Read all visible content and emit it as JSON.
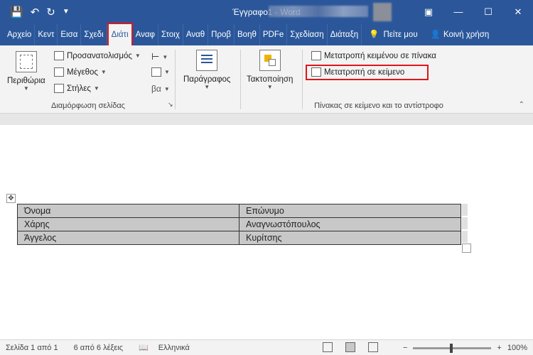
{
  "window": {
    "title": "Έγγραφο1 - Word",
    "quick_access": {
      "save_icon": "save-icon",
      "undo_icon": "undo-icon",
      "redo_icon": "redo-icon",
      "customize_icon": "customize-icon"
    },
    "controls": {
      "minimize": "—",
      "restore": "☐",
      "close": "✕",
      "ribbon_display": "▣"
    }
  },
  "tabs": [
    "Αρχείο",
    "Κεντ",
    "Εισα",
    "Σχεδι",
    "Διάτι",
    "Αναφ",
    "Στοιχ",
    "Αναθ",
    "Προβ",
    "Βοηθ",
    "PDFe",
    "Σχεδίαση",
    "Διάταξη"
  ],
  "tell_me": "Πείτε μου",
  "share": "Κοινή χρήση",
  "ribbon": {
    "page_setup": {
      "label": "Διαμόρφωση σελίδας",
      "margins": "Περιθώρια",
      "orientation": "Προσανατολισμός",
      "size": "Μέγεθος",
      "columns": "Στήλες",
      "hyphenation": "βα"
    },
    "paragraph": {
      "label": "Παράγραφος"
    },
    "arrange": {
      "label": "Τακτοποίηση"
    },
    "convert": {
      "label": "Πίνακας σε κείμενο και το αντίστροφο",
      "text_to_table": "Μετατροπή κειμένου σε πίνακα",
      "table_to_text": "Μετατροπή σε κείμενο"
    }
  },
  "table": [
    [
      "Όνομα",
      "Επώνυμο"
    ],
    [
      "Χάρης",
      "Αναγνωστόπουλος"
    ],
    [
      "Άγγελος",
      "Κυρίτσης"
    ]
  ],
  "status": {
    "page": "Σελίδα 1 από 1",
    "words": "6 από 6 λέξεις",
    "language": "Ελληνικά",
    "zoom": "100%"
  },
  "colors": {
    "accent": "#2b579a",
    "highlight": "#e0151c"
  }
}
